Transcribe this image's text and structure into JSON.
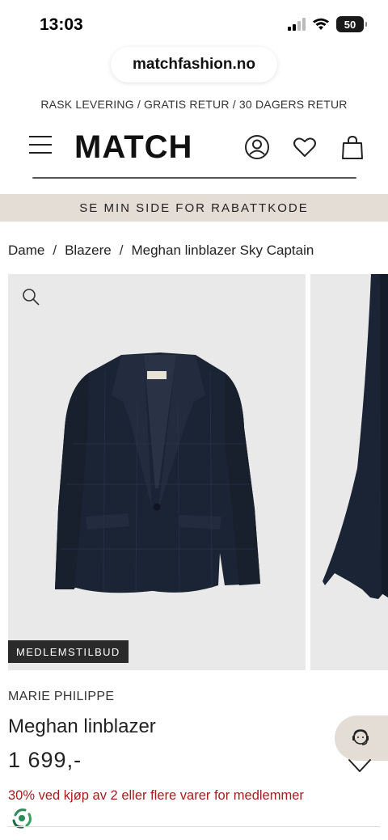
{
  "status_bar": {
    "time": "13:03",
    "battery": "50"
  },
  "browser": {
    "url": "matchfashion.no"
  },
  "promo": "RASK LEVERING / GRATIS RETUR / 30 DAGERS RETUR",
  "header": {
    "logo": "MATCH"
  },
  "banner": "SE MIN SIDE FOR RABATTKODE",
  "breadcrumb": [
    "Dame",
    "Blazere",
    "Meghan linblazer Sky Captain"
  ],
  "badge": "MEDLEMSTILBUD",
  "product": {
    "brand": "MARIE PHILIPPE",
    "name": "Meghan linblazer",
    "price": "1 699,-",
    "offer": "30% ved kjøp av 2 eller flere varer for medlemmer"
  },
  "colors": {
    "banner_bg": "#e4ddd6",
    "offer_red": "#a51d1d",
    "blazer_navy": "#1b2434",
    "badge_bg": "#2a2a2a"
  },
  "icons": [
    "menu-icon",
    "user-icon",
    "heart-icon",
    "bag-icon",
    "zoom-icon",
    "chat-agent-icon",
    "wishlist-icon",
    "recycle-icon"
  ]
}
